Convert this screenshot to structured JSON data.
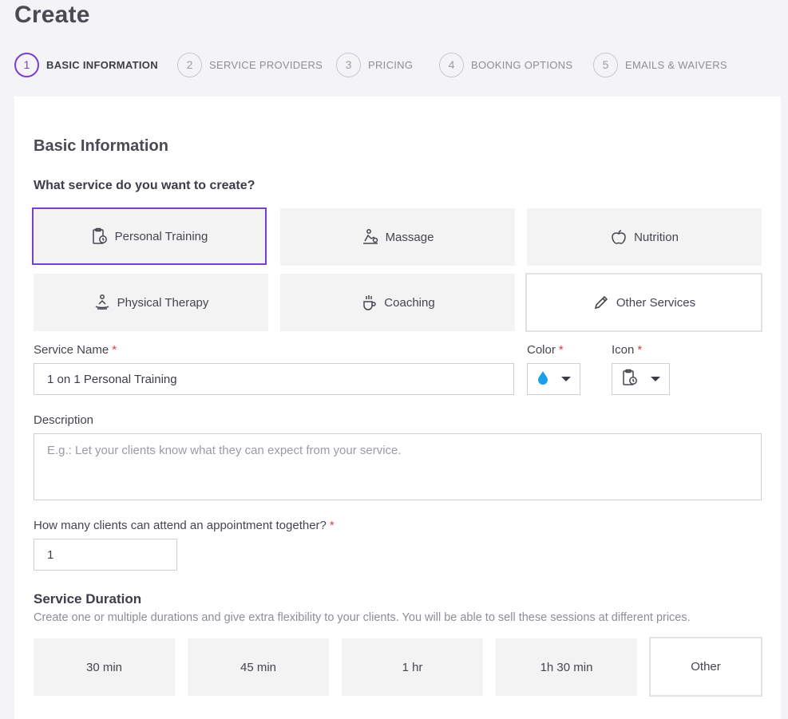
{
  "page": {
    "title": "Create"
  },
  "steps": [
    {
      "num": "1",
      "label": "BASIC INFORMATION"
    },
    {
      "num": "2",
      "label": "SERVICE PROVIDERS"
    },
    {
      "num": "3",
      "label": "PRICING"
    },
    {
      "num": "4",
      "label": "BOOKING OPTIONS"
    },
    {
      "num": "5",
      "label": "EMAILS & WAIVERS"
    }
  ],
  "form": {
    "section_title": "Basic Information",
    "question": "What service do you want to create?",
    "services": [
      {
        "label": "Personal Training",
        "icon": "clipboard-clock-icon",
        "selected": true
      },
      {
        "label": "Massage",
        "icon": "massage-icon"
      },
      {
        "label": "Nutrition",
        "icon": "apple-icon"
      },
      {
        "label": "Physical Therapy",
        "icon": "therapy-icon"
      },
      {
        "label": "Coaching",
        "icon": "coaching-icon"
      },
      {
        "label": "Other Services",
        "icon": "pencil-icon"
      }
    ],
    "service_name_label": "Service Name",
    "service_name_value": "1 on 1 Personal Training",
    "color_label": "Color",
    "color_value": "#1aa0e8",
    "icon_label": "Icon",
    "description_label": "Description",
    "description_placeholder": "E.g.: Let your clients know what they can expect from your service.",
    "clients_label": "How many clients can attend an appointment together?",
    "clients_value": "1",
    "required_mark": "*"
  },
  "duration": {
    "title": "Service Duration",
    "subtitle": "Create one or multiple durations and give extra flexibility to your clients. You will be able to sell these sessions at different prices.",
    "options": [
      "30 min",
      "45 min",
      "1 hr",
      "1h 30 min",
      "Other"
    ]
  },
  "colors": {
    "accent": "#7b3fcf",
    "required": "#e53b3b"
  }
}
